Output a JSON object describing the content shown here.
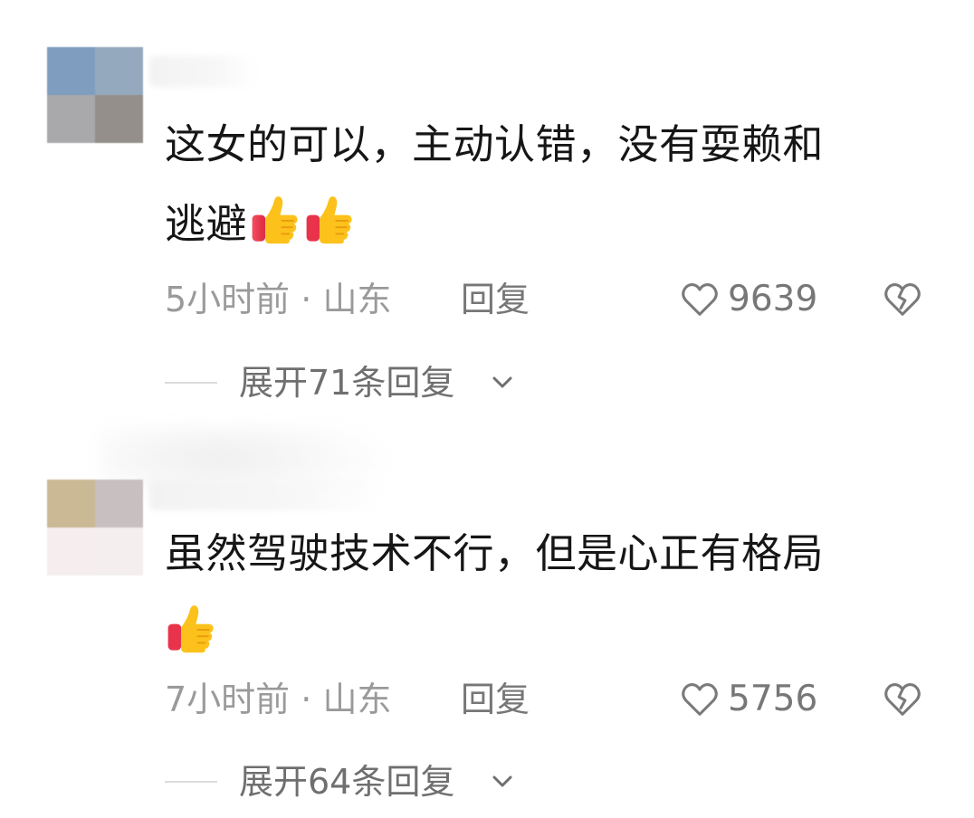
{
  "comments": [
    {
      "text_line1": "这女的可以，主动认错，没有耍赖和",
      "text_line2": "逃避",
      "time": "5小时前",
      "separator": "·",
      "location": "山东",
      "reply_label": "回复",
      "like_count": "9639",
      "expand_label": "展开71条回复",
      "thumbs_count": 2,
      "avatar_colors": [
        "#7e9dbf",
        "#95a9be",
        "#a9a9ab",
        "#948f8a"
      ]
    },
    {
      "text_line1": "虽然驾驶技术不行，但是心正有格局",
      "text_line2": "",
      "time": "7小时前",
      "separator": "·",
      "location": "山东",
      "reply_label": "回复",
      "like_count": "5756",
      "expand_label": "展开64条回复",
      "thumbs_count": 1,
      "avatar_colors": [
        "#cbb895",
        "#c8c0c0",
        "#f6eeee",
        "#f4eeee"
      ]
    }
  ],
  "icons": {
    "thumbs_up": "thumbs-up-emoji-icon",
    "like": "heart-outline-icon",
    "dislike": "broken-heart-icon",
    "expand": "chevron-down-icon"
  },
  "colors": {
    "text": "#161616",
    "meta": "#9a9a9a",
    "action": "#777777"
  }
}
